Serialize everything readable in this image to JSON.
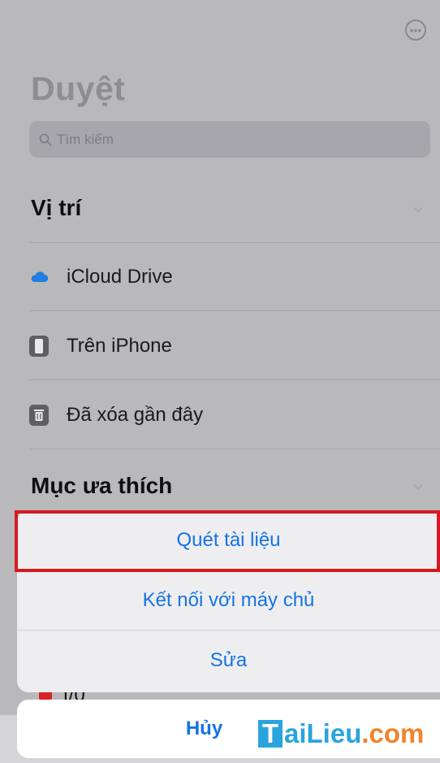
{
  "header": {
    "more_icon": "ellipsis-circle-icon",
    "title": "Duyệt",
    "search_placeholder": "Tìm kiếm"
  },
  "locations": {
    "title": "Vị trí",
    "items": [
      {
        "label": "iCloud Drive",
        "icon": "icloud-icon"
      },
      {
        "label": "Trên iPhone",
        "icon": "iphone-icon"
      },
      {
        "label": "Đã xóa gần đây",
        "icon": "trash-icon"
      }
    ]
  },
  "favorites": {
    "title": "Mục ưa thích",
    "peek_label": "t/0"
  },
  "action_sheet": {
    "items": [
      {
        "label": "Quét tài liệu",
        "highlighted": true
      },
      {
        "label": "Kết nối với máy chủ"
      },
      {
        "label": "Sửa"
      }
    ],
    "cancel_label": "Hủy"
  },
  "watermark": {
    "letter": "T",
    "rest": "aiLieu",
    "suffix": ".com"
  },
  "colors": {
    "accent": "#1473e6",
    "highlight_border": "#d81820",
    "watermark_blue": "#29a4dd",
    "watermark_orange": "#f0832b"
  }
}
